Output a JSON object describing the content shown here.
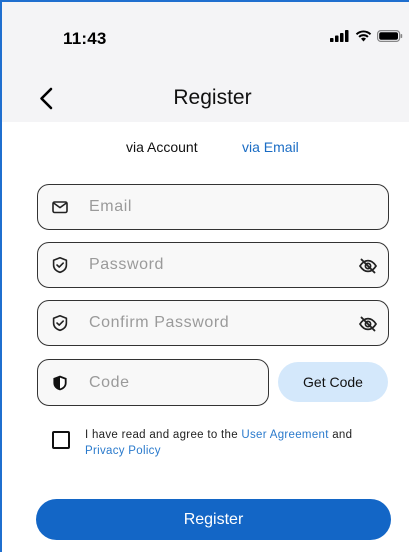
{
  "status_bar": {
    "time": "11:43"
  },
  "header": {
    "title": "Register"
  },
  "tabs": [
    {
      "label": "via Account",
      "active": false
    },
    {
      "label": "via Email",
      "active": true
    }
  ],
  "form": {
    "email_placeholder": "Email",
    "password_placeholder": "Password",
    "confirm_password_placeholder": "Confirm Password",
    "code_placeholder": "Code",
    "get_code_label": "Get Code"
  },
  "agreement": {
    "prefix": "I have read and agree to the ",
    "user_agreement": "User Agreement",
    "and": " and ",
    "privacy_policy": "Privacy Policy",
    "checked": false
  },
  "register_button": "Register",
  "colors": {
    "primary": "#1366c6",
    "link": "#2a7acc",
    "get_code_bg": "#d4e8fb",
    "header_bg": "#f4f4f6"
  },
  "icons": [
    "back-chevron-icon",
    "mail-icon",
    "shield-check-icon",
    "shield-filled-icon",
    "eye-off-icon",
    "signal-icon",
    "wifi-icon",
    "battery-icon"
  ]
}
